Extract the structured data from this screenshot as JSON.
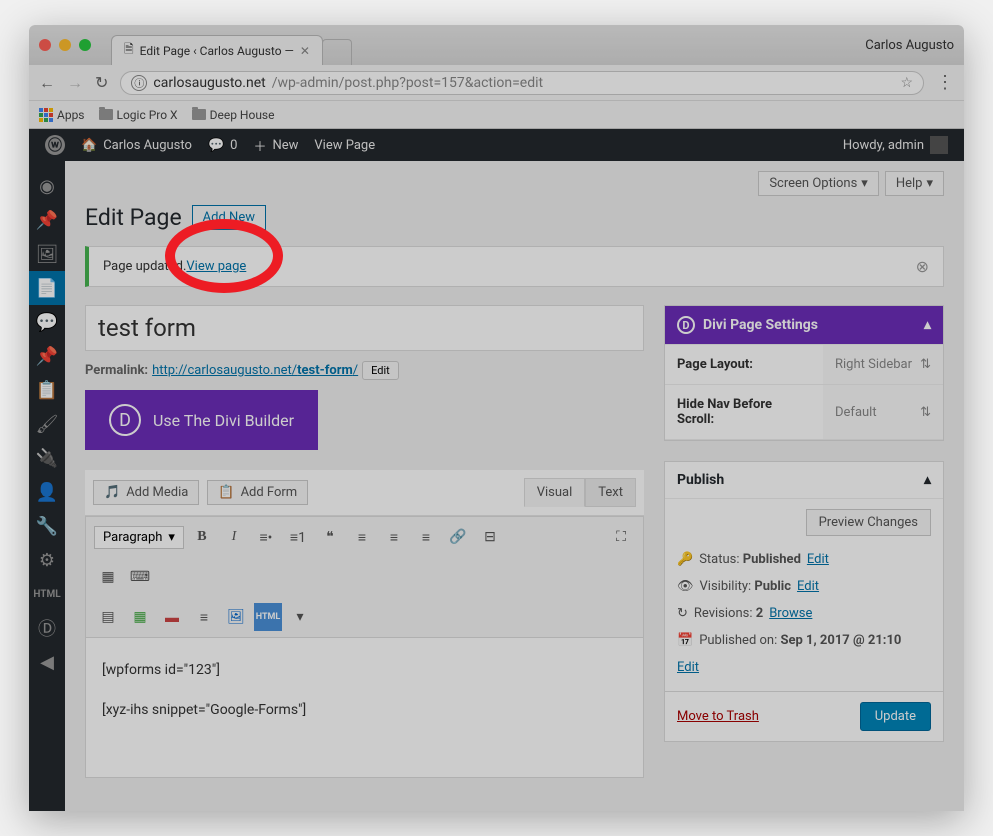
{
  "browser": {
    "tab_title": "Edit Page ‹ Carlos Augusto —",
    "profile": "Carlos Augusto",
    "url_host": "carlosaugusto.net",
    "url_path": "/wp-admin/post.php?post=157&action=edit",
    "bookmarks": {
      "apps": "Apps",
      "logic": "Logic Pro X",
      "deep": "Deep House"
    }
  },
  "adminbar": {
    "site": "Carlos Augusto",
    "comments": "0",
    "new_label": "New",
    "view_label": "View Page",
    "howdy": "Howdy, admin"
  },
  "screen": {
    "options": "Screen Options",
    "help": "Help"
  },
  "heading": {
    "title": "Edit Page",
    "add_new": "Add New"
  },
  "notice": {
    "text": "Page updated. ",
    "link": "View page"
  },
  "post": {
    "title": "test form",
    "permalink_label": "Permalink: ",
    "permalink_base": "http://carlosaugusto.net/",
    "permalink_slug": "test-form",
    "permalink_trail": "/",
    "edit_btn": "Edit"
  },
  "divi": {
    "builder_label": "Use The Divi Builder",
    "settings_title": "Divi Page Settings",
    "page_layout_label": "Page Layout:",
    "page_layout_val": "Right Sidebar",
    "hide_nav_label": "Hide Nav Before Scroll:",
    "hide_nav_val": "Default"
  },
  "editor": {
    "add_media": "Add Media",
    "add_form": "Add Form",
    "visual": "Visual",
    "text": "Text",
    "paragraph": "Paragraph",
    "shortcode1": "[wpforms id=\"123\"]",
    "shortcode2": "[xyz-ihs snippet=\"Google-Forms\"]"
  },
  "publish": {
    "title": "Publish",
    "preview": "Preview Changes",
    "status_label": "Status: ",
    "status_val": "Published",
    "edit": "Edit",
    "visibility_label": "Visibility: ",
    "visibility_val": "Public",
    "revisions_label": "Revisions: ",
    "revisions_val": "2",
    "browse": "Browse",
    "published_label": "Published on: ",
    "published_val": "Sep 1, 2017 @ 21:10",
    "trash": "Move to Trash",
    "update": "Update"
  }
}
